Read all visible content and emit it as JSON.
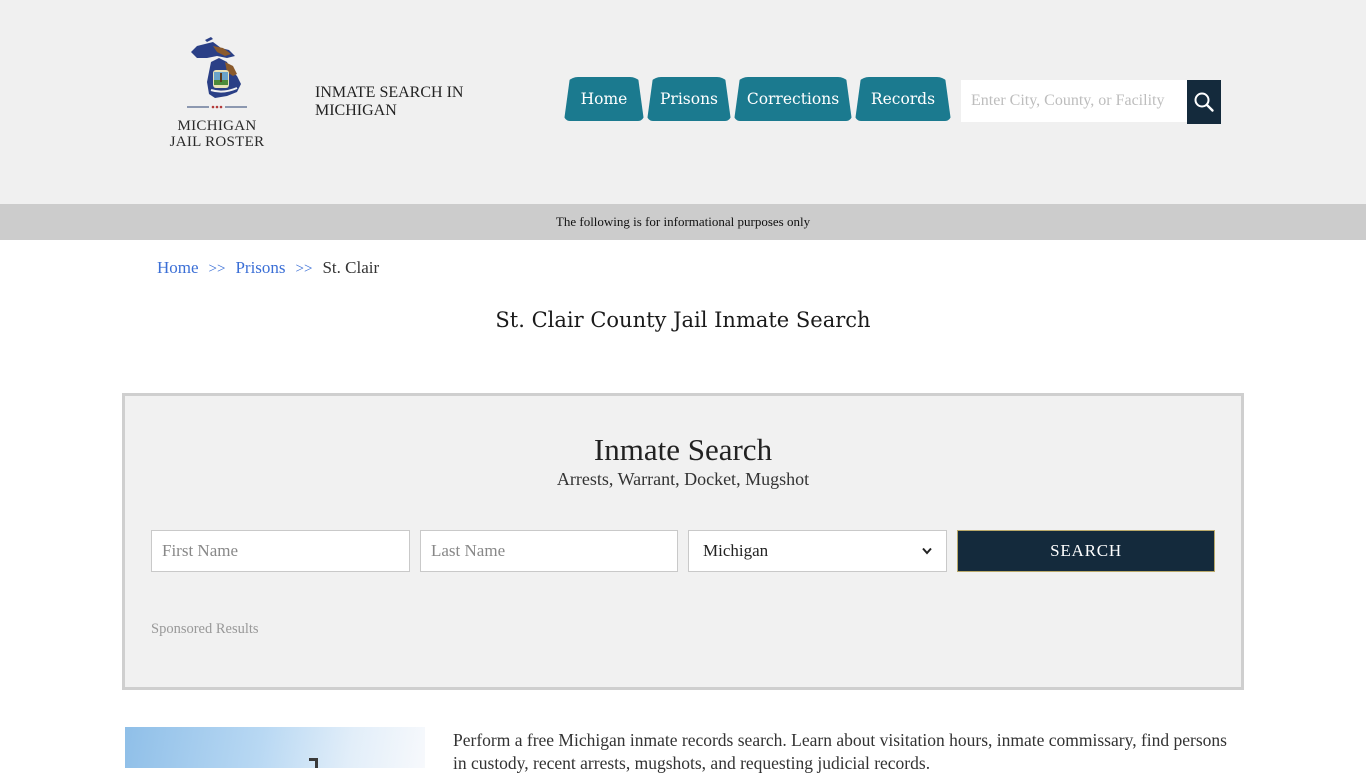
{
  "header": {
    "logo_line1": "MICHIGAN",
    "logo_line2": "JAIL ROSTER",
    "tagline": "INMATE SEARCH IN MICHIGAN",
    "nav": [
      {
        "label": "Home"
      },
      {
        "label": "Prisons"
      },
      {
        "label": "Corrections"
      },
      {
        "label": "Records"
      }
    ],
    "search_placeholder": "Enter City, County, or Facility",
    "search_icon": "magnifier-icon",
    "nav_color": "#1b7a8f",
    "search_button_color": "#142a3c"
  },
  "info_bar": {
    "text": "The following is for informational purposes only"
  },
  "breadcrumb": {
    "items": [
      {
        "label": "Home"
      },
      {
        "label": "Prisons"
      },
      {
        "label": "St. Clair"
      }
    ],
    "separator": ">>"
  },
  "page_title": "St. Clair County Jail Inmate Search",
  "search_panel": {
    "title": "Inmate Search",
    "subtitle": "Arrests, Warrant, Docket, Mugshot",
    "first_name_placeholder": "First Name",
    "last_name_placeholder": "Last Name",
    "state_selected": "Michigan",
    "search_label": "SEARCH",
    "sponsored": "Sponsored Results"
  },
  "intro": {
    "text": "Perform a free Michigan inmate records search. Learn about visitation hours, inmate commissary, find persons in custody, recent arrests, mugshots, and requesting judicial records."
  }
}
